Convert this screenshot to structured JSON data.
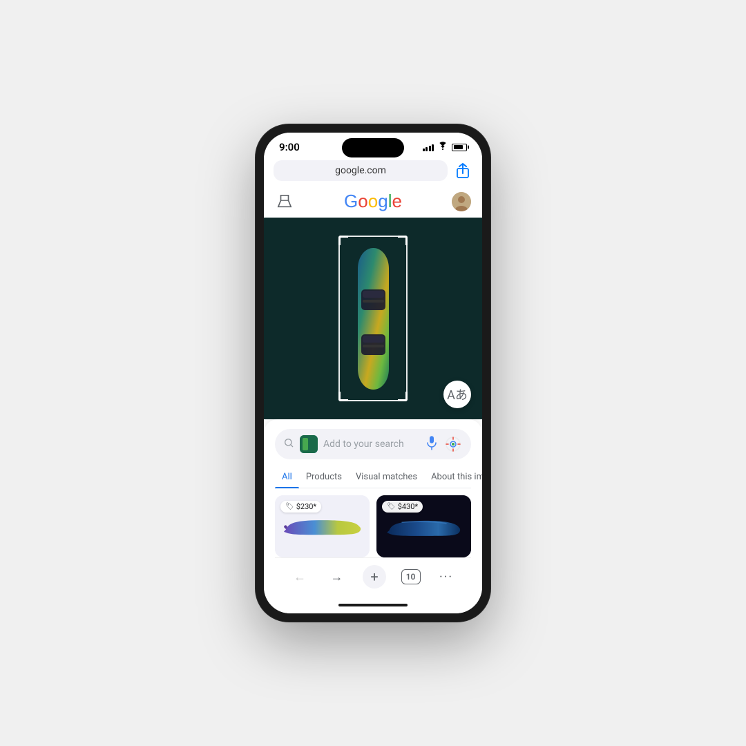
{
  "status_bar": {
    "time": "9:00",
    "signal_bars": [
      4,
      6,
      8,
      10,
      12
    ],
    "battery_pct": 80
  },
  "browser": {
    "url": "google.com",
    "share_icon": "↑"
  },
  "google_header": {
    "labs_icon": "⚗",
    "logo_letters": [
      {
        "char": "G",
        "color_class": "g-blue"
      },
      {
        "char": "o",
        "color_class": "g-red"
      },
      {
        "char": "o",
        "color_class": "g-yellow"
      },
      {
        "char": "g",
        "color_class": "g-blue"
      },
      {
        "char": "l",
        "color_class": "g-green"
      },
      {
        "char": "e",
        "color_class": "g-red"
      }
    ]
  },
  "search_bar": {
    "placeholder": "Add to your search",
    "mic_icon": "mic",
    "lens_icon": "lens"
  },
  "tabs": [
    {
      "label": "All",
      "active": true
    },
    {
      "label": "Products",
      "active": false
    },
    {
      "label": "Visual matches",
      "active": false
    },
    {
      "label": "About this image",
      "active": false
    }
  ],
  "products": [
    {
      "price": "$230*",
      "bg": "light"
    },
    {
      "price": "$430*",
      "bg": "dark"
    }
  ],
  "browser_nav": {
    "back": "←",
    "forward": "→",
    "plus": "+",
    "tabs_count": "10",
    "more": "···"
  },
  "translate_button": "Aあ"
}
